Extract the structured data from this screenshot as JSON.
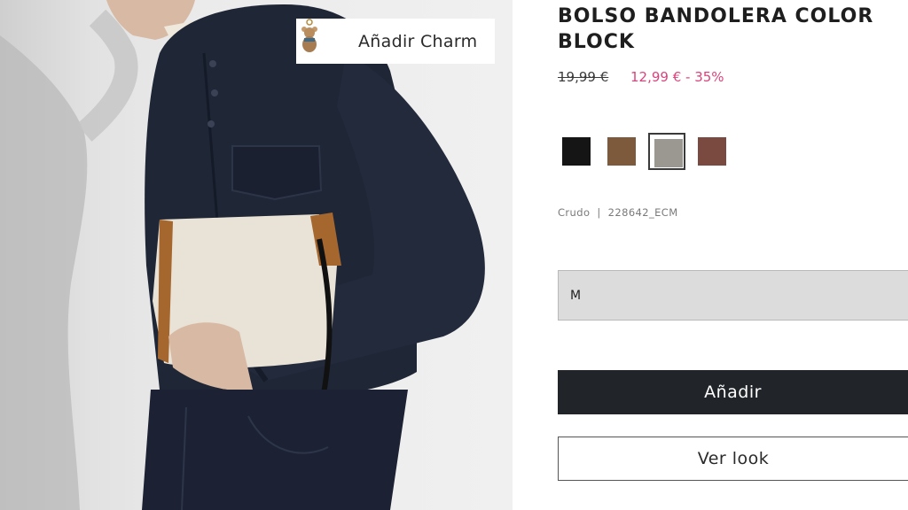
{
  "product": {
    "title": "BOLSO BANDOLERA COLOR BLOCK",
    "price_old": "19,99 €",
    "price_new": "12,99 € - 35%",
    "color_name": "Crudo",
    "reference": "228642_ECM",
    "selected_size": "M"
  },
  "charm": {
    "label": "Añadir Charm",
    "thumb_icon": "teddy-bear-charm-icon"
  },
  "swatches": [
    {
      "color": "#151515",
      "selected": false
    },
    {
      "color": "#7d5a3c",
      "selected": false
    },
    {
      "color": "#9a9891",
      "selected": true
    },
    {
      "color": "#7a4a40",
      "selected": false
    }
  ],
  "actions": {
    "add_label": "Añadir",
    "look_label": "Ver look"
  },
  "colors": {
    "accent_price": "#d9437d",
    "primary_button": "#212529"
  }
}
